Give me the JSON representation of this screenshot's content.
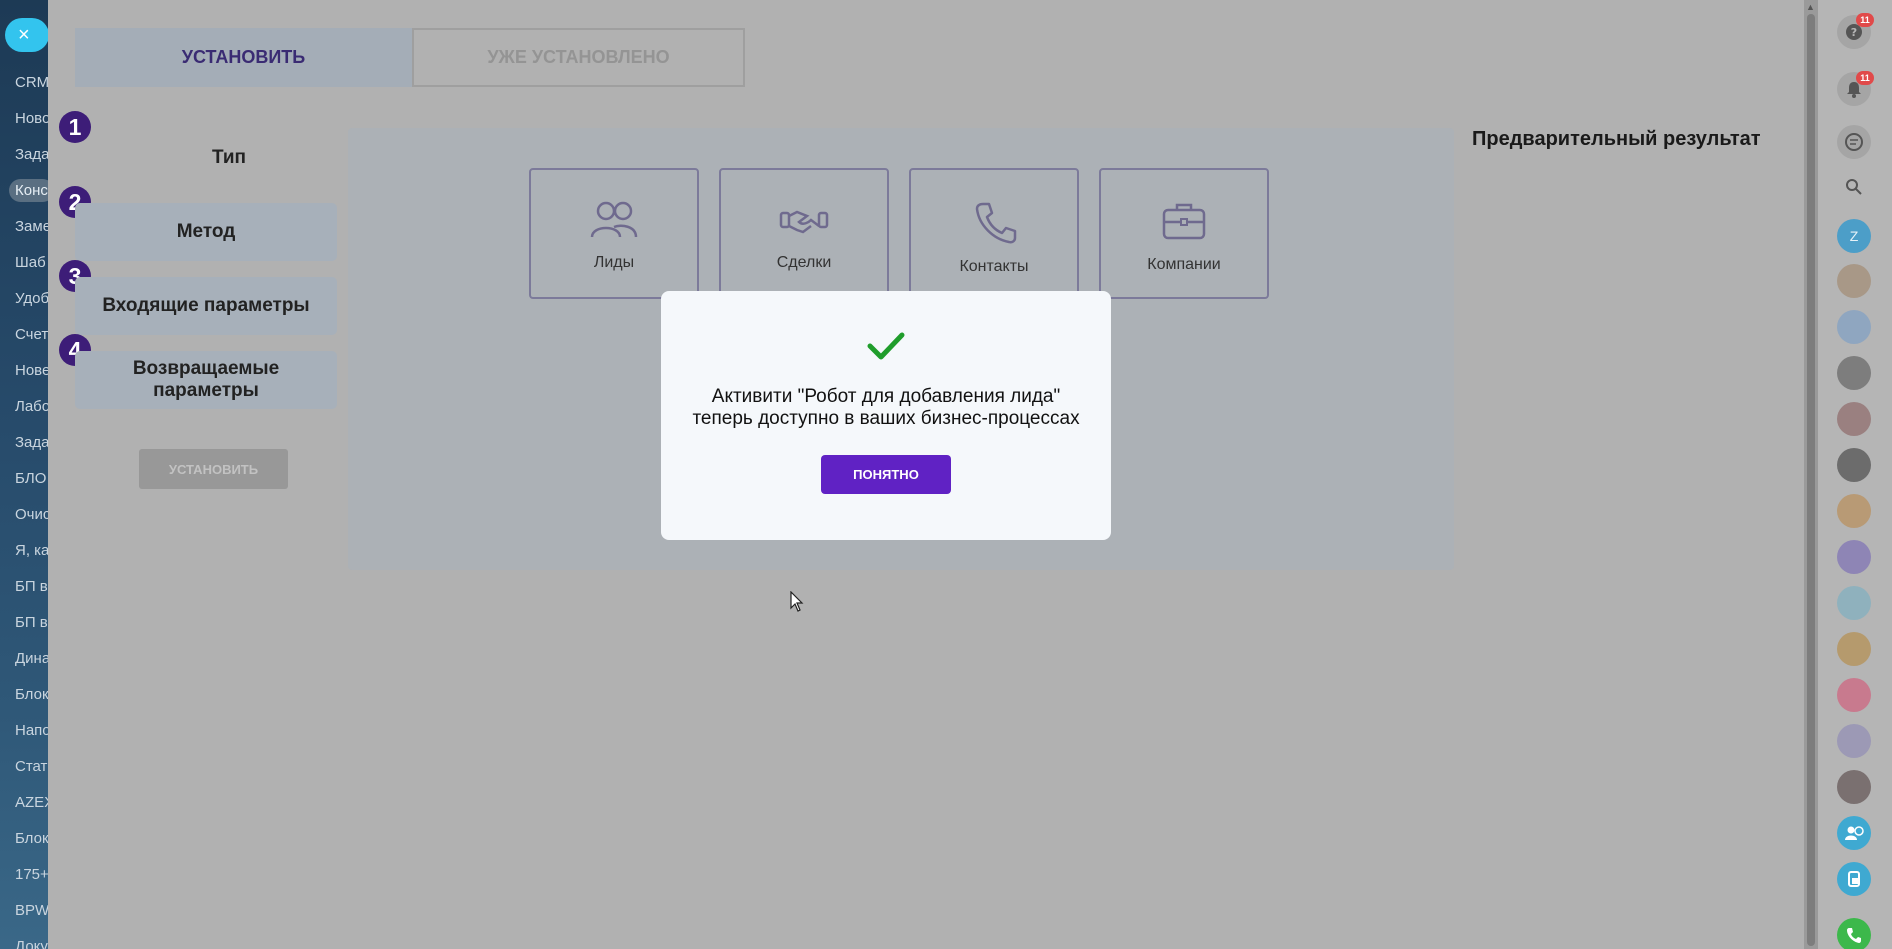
{
  "left_nav": {
    "close_icon": "×",
    "items": [
      "CRM",
      "Ново",
      "Зада",
      "Конс",
      "Заме",
      "Шаб",
      "Удоб",
      "Счет",
      "Нове",
      "Лабо",
      "Зада",
      "БЛО",
      "Очис",
      "Я, ка",
      "БП в",
      "БП в",
      "Дина",
      "Блок",
      "Напо",
      "Стат",
      "AZEX",
      "Блок",
      "175+",
      "BPW",
      "Доку"
    ]
  },
  "tabs": {
    "install": "УСТАНОВИТЬ",
    "installed": "УЖЕ УСТАНОВЛЕНО"
  },
  "steps": [
    {
      "number": "1",
      "label": "Тип"
    },
    {
      "number": "2",
      "label": "Метод"
    },
    {
      "number": "3",
      "label": "Входящие параметры"
    },
    {
      "number": "4",
      "label": "Возвращаемые параметры"
    }
  ],
  "install_button": "УСТАНОВИТЬ",
  "entities": [
    {
      "label": "Лиды",
      "icon": "people-icon"
    },
    {
      "label": "Сделки",
      "icon": "handshake-icon"
    },
    {
      "label": "Контакты",
      "icon": "phone-icon"
    },
    {
      "label": "Компании",
      "icon": "briefcase-icon"
    }
  ],
  "preview": {
    "title": "Предварительный результат"
  },
  "modal": {
    "line1": "Активити \"Робот для добавления лида\"",
    "line2": "теперь доступно в ваших бизнес-процессах",
    "button": "ПОНЯТНО",
    "check_color": "#1f9d2b",
    "button_color": "#6022c4"
  },
  "right_panel": {
    "help_badge": "11",
    "notifications_badge": "11",
    "user_initial": "Z"
  }
}
